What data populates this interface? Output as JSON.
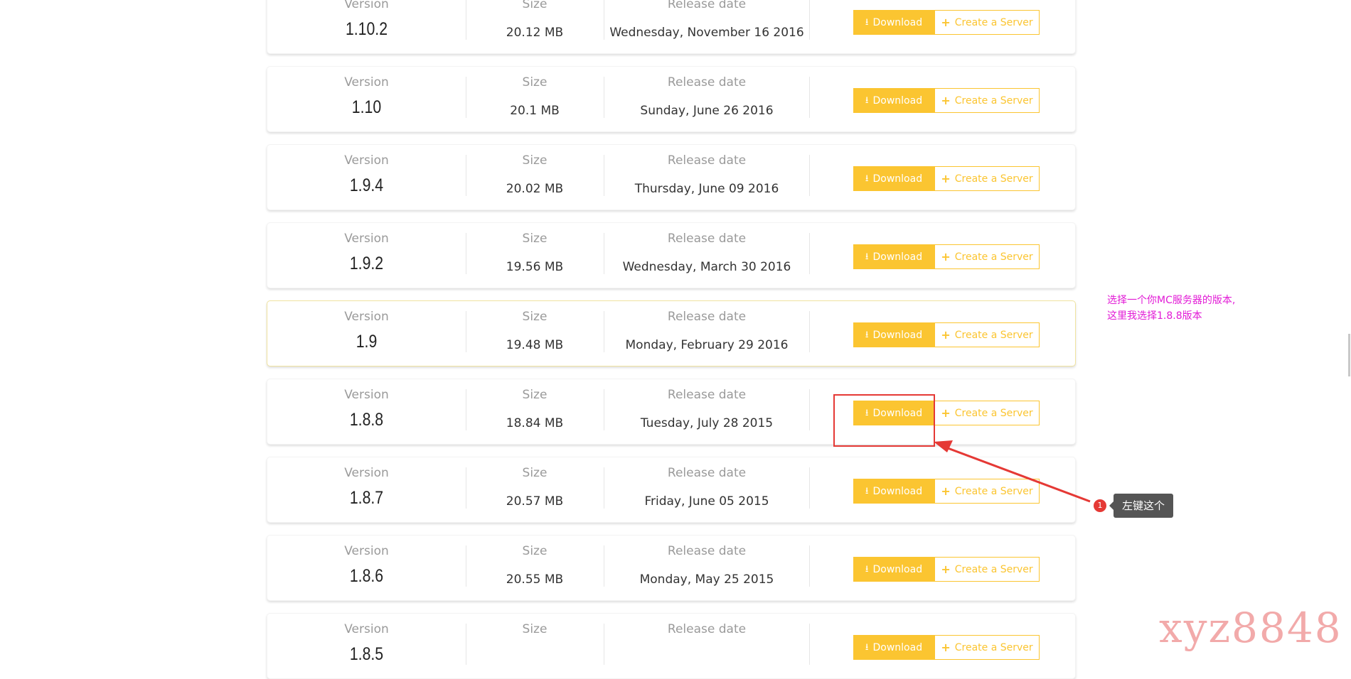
{
  "labels": {
    "version": "Version",
    "size": "Size",
    "release_date": "Release date",
    "download": "Download",
    "create_server": "Create a Server"
  },
  "releases": [
    {
      "version": "1.10.2",
      "size": "20.12 MB",
      "date": "Wednesday, November 16 2016"
    },
    {
      "version": "1.10",
      "size": "20.1 MB",
      "date": "Sunday, June 26 2016"
    },
    {
      "version": "1.9.4",
      "size": "20.02 MB",
      "date": "Thursday, June 09 2016"
    },
    {
      "version": "1.9.2",
      "size": "19.56 MB",
      "date": "Wednesday, March 30 2016"
    },
    {
      "version": "1.9",
      "size": "19.48 MB",
      "date": "Monday, February 29 2016",
      "highlighted": true
    },
    {
      "version": "1.8.8",
      "size": "18.84 MB",
      "date": "Tuesday, July 28 2015",
      "annotated": true
    },
    {
      "version": "1.8.7",
      "size": "20.57 MB",
      "date": "Friday, June 05 2015"
    },
    {
      "version": "1.8.6",
      "size": "20.55 MB",
      "date": "Monday, May 25 2015"
    },
    {
      "version": "1.8.5",
      "size": "",
      "date": ""
    }
  ],
  "annotations": {
    "note_line1": "选择一个你MC服务器的版本,",
    "note_line2": "这里我选择1.8.8版本",
    "step_number": "1",
    "step_text": "左键这个",
    "watermark": "xyz8848"
  },
  "colors": {
    "accent": "#fbc531",
    "annotation_red": "#e53935",
    "note_magenta": "#e21bd6",
    "watermark": "#f2aaaa"
  },
  "icons": {
    "download": "download-icon",
    "create": "plus-icon"
  }
}
